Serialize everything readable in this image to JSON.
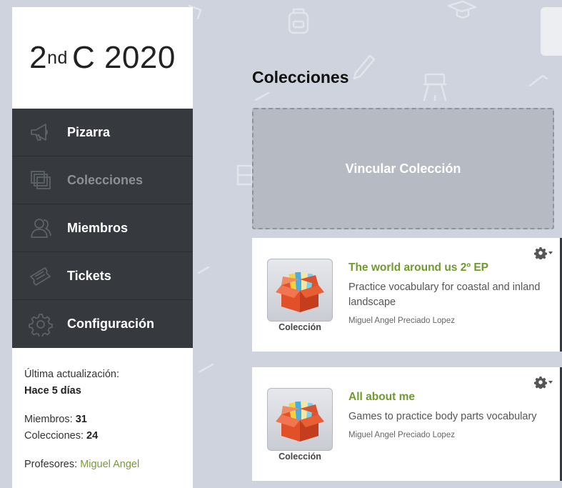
{
  "sidebar": {
    "class_name_num": "2",
    "class_name_sup": "nd",
    "class_name_rest": "C 2020",
    "nav": [
      {
        "label": "Pizarra",
        "icon": "megaphone-icon",
        "active": false
      },
      {
        "label": "Colecciones",
        "icon": "stack-icon",
        "active": true
      },
      {
        "label": "Miembros",
        "icon": "members-icon",
        "active": false
      },
      {
        "label": "Tickets",
        "icon": "ticket-icon",
        "active": false
      },
      {
        "label": "Configuración",
        "icon": "gear-icon",
        "active": false
      }
    ],
    "info": {
      "last_update_label": "Última actualización:",
      "last_update_value": "Hace 5 días",
      "members_label": "Miembros:",
      "members_value": "31",
      "collections_label": "Colecciones:",
      "collections_value": "24",
      "teachers_label": "Profesores:",
      "teachers_value": "Miguel Angel"
    }
  },
  "main": {
    "title": "Colecciones",
    "link_collection_label": "Vincular Colección",
    "cards": [
      {
        "title": "The world around us 2º EP",
        "description": "Practice vocabulary for coastal and inland landscape",
        "author": "Miguel Angel Preciado Lopez",
        "thumb_label": "Colección"
      },
      {
        "title": "All about me",
        "description": "Games to practice body parts vocabulary",
        "author": "Miguel Angel Preciado Lopez",
        "thumb_label": "Colección"
      }
    ]
  },
  "colors": {
    "background": "#cfd3dd",
    "nav_bg": "#363a3e",
    "accent_green": "#6f9a2e"
  }
}
